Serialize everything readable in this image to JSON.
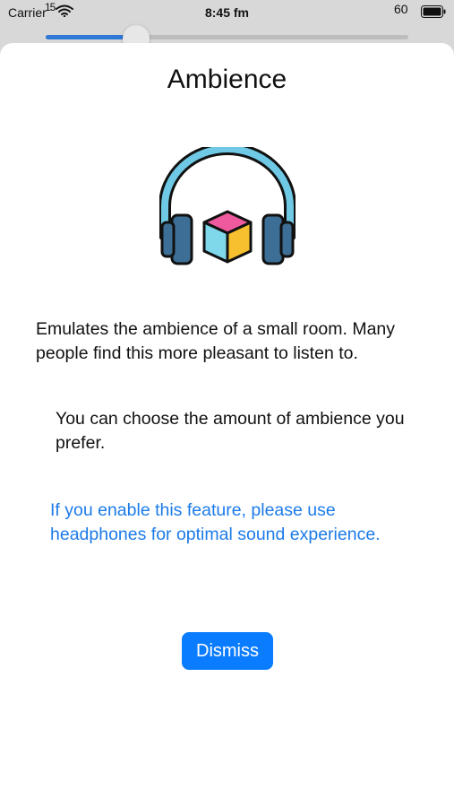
{
  "status_bar": {
    "carrier": "Carrier",
    "signal": "15",
    "time": "8:45 fm",
    "battery": "60",
    "wifi_icon": "wifi-icon",
    "battery_icon": "battery-icon"
  },
  "background": {
    "slider": {
      "value_fraction": 0.22,
      "accent_color": "#2f78d6"
    }
  },
  "sheet": {
    "title": "Ambience",
    "hero_icon": "headphones-cube-icon",
    "description": "Emulates the ambience of a small room. Many people find this more pleasant to listen to.",
    "choice_text": "You can choose the amount of ambience you prefer.",
    "headphones_note": "If you enable this feature, please use headphones for optimal sound experience.",
    "dismiss_label": "Dismiss",
    "colors": {
      "note_text": "#1c7be8",
      "button_bg": "#0a7cff",
      "button_text": "#ffffff",
      "sheet_bg": "#ffffff"
    }
  }
}
